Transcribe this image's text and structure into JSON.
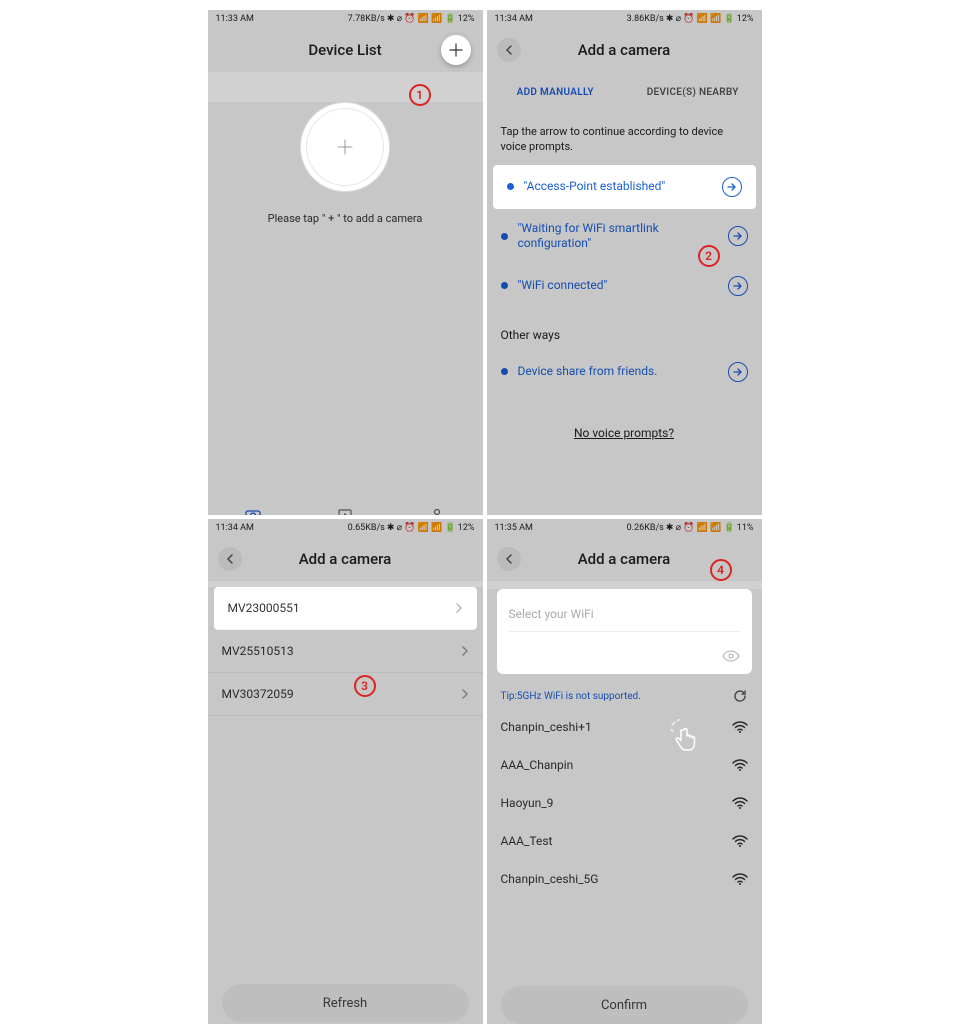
{
  "s1": {
    "status_time": "11:33 AM",
    "status_net": "7.78KB/s",
    "status_batt": "12%",
    "title": "Device List",
    "hint_pre": "Please tap",
    "hint_plus": "\" + \"",
    "hint_post": "to add a camera",
    "nav": {
      "device_list": "Device List",
      "demo": "Demo",
      "profile": "Profile"
    },
    "annot": "1"
  },
  "s2": {
    "status_time": "11:34 AM",
    "status_net": "3.86KB/s",
    "status_batt": "12%",
    "title": "Add a camera",
    "tabs": {
      "manual": "ADD MANUALLY",
      "nearby": "DEVICE(S) NEARBY"
    },
    "note": "Tap the arrow to continue according to device voice prompts.",
    "opt1": "\"Access-Point established\"",
    "opt2": "\"Waiting for WiFi smartlink configuration\"",
    "opt3": "\"WiFi connected\"",
    "other_ways": "Other ways",
    "opt4": "Device share from friends.",
    "no_prompts": "No voice prompts?",
    "annot": "2"
  },
  "s3": {
    "status_time": "11:34 AM",
    "status_net": "0.65KB/s",
    "status_batt": "12%",
    "title": "Add a camera",
    "dev1": "MV23000551",
    "dev2": "MV25510513",
    "dev3": "MV30372059",
    "refresh": "Refresh",
    "annot": "3"
  },
  "s4": {
    "status_time": "11:35 AM",
    "status_net": "0.26KB/s",
    "status_batt": "11%",
    "title": "Add a camera",
    "select_wifi": "Select your WiFi",
    "tip": "Tip:5GHz WiFi is not supported.",
    "w1": "Chanpin_ceshi+1",
    "w2": "AAA_Chanpin",
    "w3": "Haoyun_9",
    "w4": "AAA_Test",
    "w5": "Chanpin_ceshi_5G",
    "confirm": "Confirm",
    "annot": "4"
  }
}
